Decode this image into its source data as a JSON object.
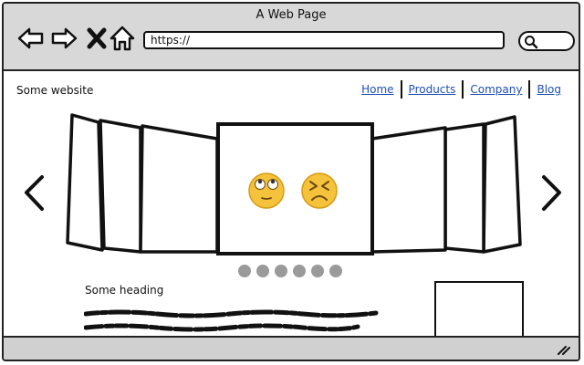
{
  "window": {
    "title": "A Web Page"
  },
  "toolbar": {
    "back_icon": "left-arrow-icon",
    "forward_icon": "right-arrow-icon",
    "stop_icon": "close-x-icon",
    "home_icon": "house-icon",
    "search_icon": "magnifier-icon"
  },
  "address": {
    "value": "https://"
  },
  "site": {
    "name": "Some website"
  },
  "nav": {
    "items": [
      "Home",
      "Products",
      "Company",
      "Blog"
    ]
  },
  "carousel": {
    "prev_icon": "chevron-left-icon",
    "next_icon": "chevron-right-icon",
    "center_icons": [
      "eye-roll-emoji-icon",
      "frustrated-emoji-icon"
    ],
    "dots": 6
  },
  "section": {
    "heading": "Some heading"
  },
  "colors": {
    "link": "#1f4fb0",
    "chrome": "#d8d8d8",
    "emoji": "#f5c33b"
  }
}
